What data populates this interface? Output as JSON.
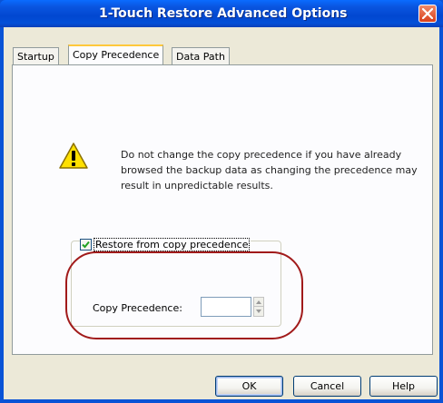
{
  "window": {
    "title": "1-Touch Restore Advanced Options"
  },
  "tabs": [
    {
      "label": "Startup",
      "active": false
    },
    {
      "label": "Copy Precedence",
      "active": true
    },
    {
      "label": "Data Path",
      "active": false
    }
  ],
  "warning": {
    "icon": "warning-triangle-icon",
    "text": "Do not change the copy precedence if you have already browsed the backup data as changing the precedence may result in unpredictable results."
  },
  "restore_option": {
    "checkbox_label": "Restore from copy precedence",
    "checked": true,
    "copy_precedence_label": "Copy Precedence:",
    "copy_precedence_value": ""
  },
  "buttons": {
    "ok": "OK",
    "cancel": "Cancel",
    "help": "Help"
  },
  "colors": {
    "titlebar": "#0a55e0",
    "highlight_circle": "#a11a1a",
    "active_tab_accent": "#ffc83c"
  }
}
